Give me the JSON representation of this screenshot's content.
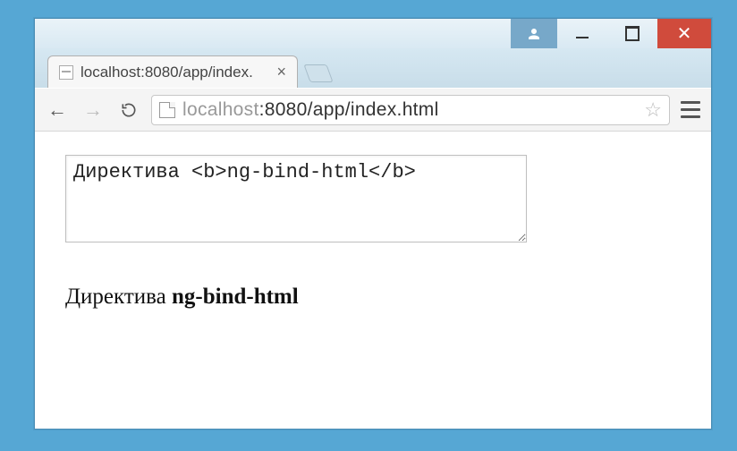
{
  "window": {
    "close_glyph": "✕",
    "user_glyph": "👤"
  },
  "tab": {
    "title": "localhost:8080/app/index.",
    "close_glyph": "×"
  },
  "toolbar": {
    "back_glyph": "←",
    "forward_glyph": "→",
    "url_host": "localhost",
    "url_path": ":8080/app/index.html",
    "star_glyph": "☆"
  },
  "page": {
    "textarea_value": "Директива <b>ng-bind-html</b>",
    "rendered_prefix": "Директива ",
    "rendered_bold": "ng-bind-html"
  }
}
